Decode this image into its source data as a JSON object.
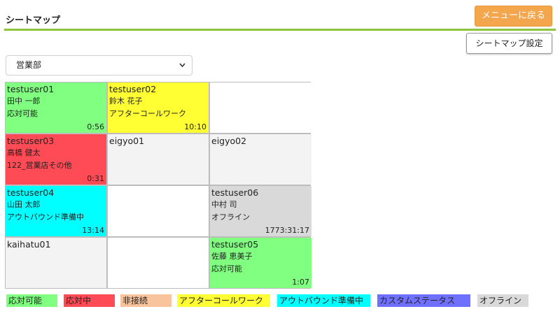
{
  "header": {
    "title": "シートマップ",
    "menu_button_label": "メニューに戻る",
    "settings_button_label": "シートマップ設定",
    "accent_color": "#8cc63f",
    "menu_button_color": "#f4a64c"
  },
  "department_select": {
    "selected": "営業部",
    "icon": "chevron-down-icon"
  },
  "seats": [
    {
      "id": "testuser01",
      "name": "田中 一郎",
      "status": "応対可能",
      "time": "0:56",
      "color": "#80ff80"
    },
    {
      "id": "testuser02",
      "name": "鈴木 花子",
      "status": "アフターコールワーク",
      "time": "10:10",
      "color": "#ffff33"
    },
    {
      "id": "",
      "name": "",
      "status": "",
      "time": "",
      "color": "#ffffff"
    },
    {
      "id": "testuser03",
      "name": "高橋 健太",
      "status": "122_営業店その他",
      "time": "0:31",
      "color": "#ff4b55"
    },
    {
      "id": "eigyo01",
      "name": "",
      "status": "",
      "time": "",
      "color": "#f3f3f3"
    },
    {
      "id": "eigyo02",
      "name": "",
      "status": "",
      "time": "",
      "color": "#f3f3f3"
    },
    {
      "id": "testuser04",
      "name": "山田 太郎",
      "status": "アウトバウンド準備中",
      "time": "13:14",
      "color": "#00ffff"
    },
    {
      "id": "",
      "name": "",
      "status": "",
      "time": "",
      "color": "#ffffff"
    },
    {
      "id": "testuser06",
      "name": "中村 司",
      "status": "オフライン",
      "time": "1773:31:17",
      "color": "#d9d9d9"
    },
    {
      "id": "kaihatu01",
      "name": "",
      "status": "",
      "time": "",
      "color": "#f3f3f3"
    },
    {
      "id": "",
      "name": "",
      "status": "",
      "time": "",
      "color": "#ffffff"
    },
    {
      "id": "testuser05",
      "name": "佐藤 恵美子",
      "status": "応対可能",
      "time": "1:07",
      "color": "#80ff80"
    }
  ],
  "legend": [
    {
      "label": "応対可能",
      "color": "#80ff80"
    },
    {
      "label": "応対中",
      "color": "#ff4b55"
    },
    {
      "label": "非接続",
      "color": "#f9c39b"
    },
    {
      "label": "アフターコールワーク",
      "color": "#ffff33"
    },
    {
      "label": "アウトバウンド準備中",
      "color": "#00ffff"
    },
    {
      "label": "カスタムステータス",
      "color": "#7070ff"
    },
    {
      "label": "オフライン",
      "color": "#d9d9d9"
    }
  ]
}
